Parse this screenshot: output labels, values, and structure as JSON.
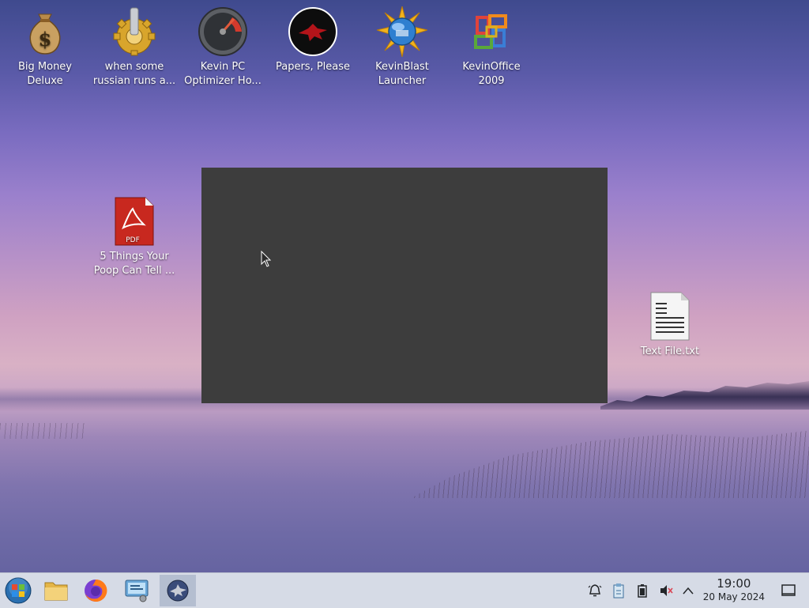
{
  "desktop": {
    "icons": [
      {
        "line1": "Big Money",
        "line2": "Deluxe",
        "icon": "money-bag-icon"
      },
      {
        "line1": "when some",
        "line2": "russian runs a...",
        "icon": "gear-icon"
      },
      {
        "line1": "Kevin PC",
        "line2": "Optimizer Ho...",
        "icon": "speedometer-icon"
      },
      {
        "line1": "Papers, Please",
        "line2": "",
        "icon": "eagle-emblem-icon"
      },
      {
        "line1": "KevinBlast",
        "line2": "Launcher",
        "icon": "globe-burst-icon"
      },
      {
        "line1": "KevinOffice",
        "line2": "2009",
        "icon": "office-logo-icon"
      },
      {
        "line1": "5 Things Your",
        "line2": "Poop Can Tell ...",
        "icon": "pdf-file-icon"
      },
      {
        "line1": "Text File.txt",
        "line2": "",
        "icon": "text-file-icon"
      }
    ],
    "pdf_badge": "PDF"
  },
  "taskbar": {
    "apps": [
      {
        "name": "start-button",
        "icon": "windows-orb-icon"
      },
      {
        "name": "file-manager",
        "icon": "folder-icon"
      },
      {
        "name": "firefox",
        "icon": "firefox-icon"
      },
      {
        "name": "control-panel",
        "icon": "system-settings-icon"
      },
      {
        "name": "active-window",
        "icon": "eagle-app-icon"
      }
    ],
    "tray": [
      "notifications-icon",
      "clipboard-icon",
      "battery-icon",
      "volume-muted-icon",
      "chevron-up-icon"
    ],
    "clock": {
      "time": "19:00",
      "date": "20 May 2024"
    }
  },
  "colors": {
    "window_bg": "#3d3d3d",
    "taskbar_bg": "#d6dbe6",
    "active_task_bg": "#b4bed0"
  }
}
